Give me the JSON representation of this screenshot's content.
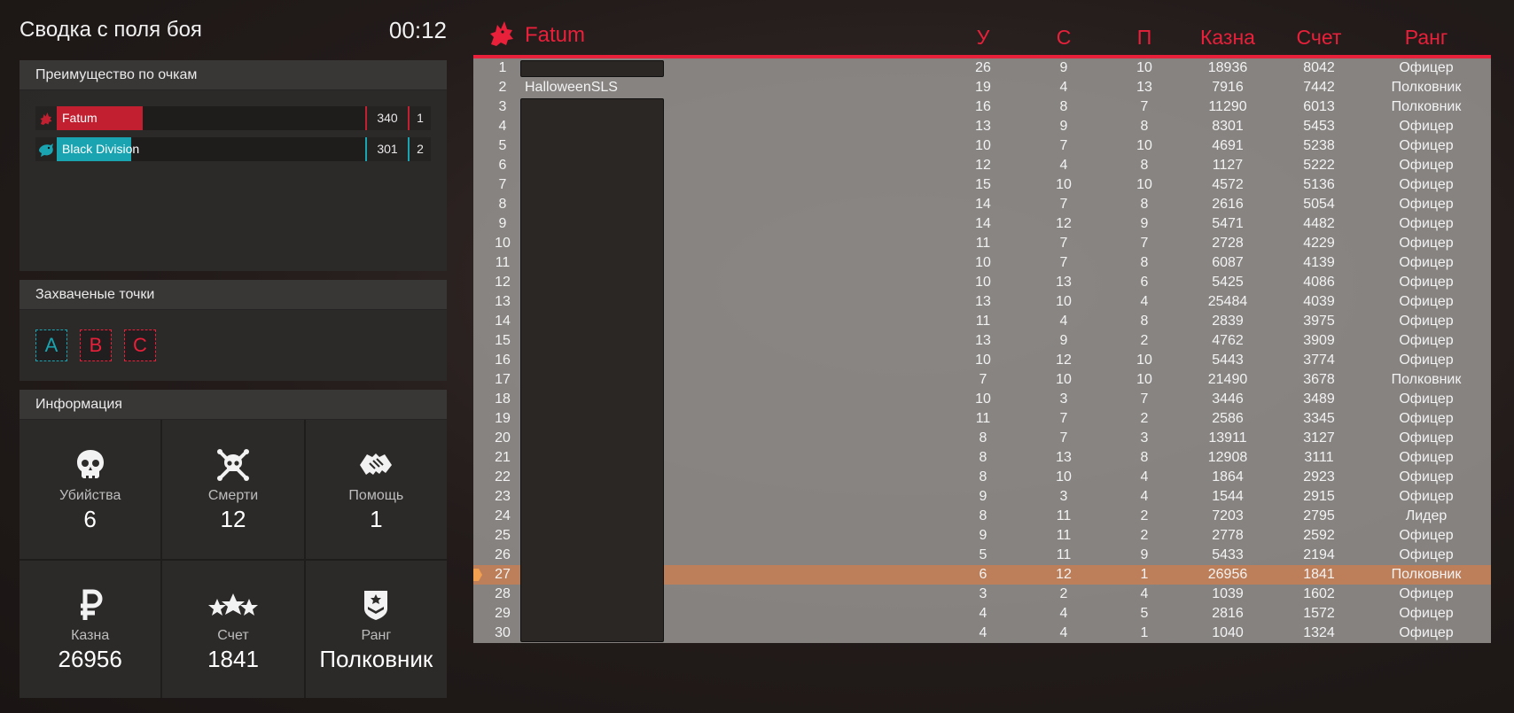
{
  "summary": {
    "title": "Сводка с поля боя",
    "timer": "00:12"
  },
  "advantage": {
    "title": "Преимущество по очкам",
    "teams": [
      {
        "name": "Fatum",
        "score": "340",
        "place": "1",
        "color": "#c22030",
        "fill_fraction": 0.28
      },
      {
        "name": "Black Division",
        "score": "301",
        "place": "2",
        "color": "#1aa3b0",
        "fill_fraction": 0.24
      }
    ]
  },
  "points": {
    "title": "Захваченые точки",
    "items": [
      {
        "label": "A",
        "color": "#1aa3b0"
      },
      {
        "label": "B",
        "color": "#e8203a"
      },
      {
        "label": "C",
        "color": "#e8203a"
      }
    ]
  },
  "info": {
    "title": "Информация",
    "kills": {
      "label": "Убийства",
      "value": "6",
      "icon": "skull-icon"
    },
    "deaths": {
      "label": "Смерти",
      "value": "12",
      "icon": "skull-crossbones-icon"
    },
    "assists": {
      "label": "Помощь",
      "value": "1",
      "icon": "handshake-icon"
    },
    "treasury": {
      "label": "Казна",
      "value": "26956",
      "icon": "ruble-icon"
    },
    "score": {
      "label": "Счет",
      "value": "1841",
      "icon": "stars-icon"
    },
    "rank": {
      "label": "Ранг",
      "value": "Полковник",
      "icon": "rank-chevron-icon"
    }
  },
  "board": {
    "team": "Fatum",
    "accent": "#e8203a",
    "columns": {
      "kills": "У",
      "deaths": "С",
      "assists": "П",
      "treasury": "Казна",
      "score": "Счет",
      "rank": "Ранг"
    },
    "visible_name": "HalloweenSLS",
    "rows": [
      {
        "n": "1",
        "name": "",
        "k": "26",
        "d": "9",
        "a": "10",
        "t": "18936",
        "s": "8042",
        "r": "Офицер"
      },
      {
        "n": "2",
        "name": "HalloweenSLS",
        "k": "19",
        "d": "4",
        "a": "13",
        "t": "7916",
        "s": "7442",
        "r": "Полковник"
      },
      {
        "n": "3",
        "name": "",
        "k": "16",
        "d": "8",
        "a": "7",
        "t": "11290",
        "s": "6013",
        "r": "Полковник"
      },
      {
        "n": "4",
        "name": "",
        "k": "13",
        "d": "9",
        "a": "8",
        "t": "8301",
        "s": "5453",
        "r": "Офицер"
      },
      {
        "n": "5",
        "name": "",
        "k": "10",
        "d": "7",
        "a": "10",
        "t": "4691",
        "s": "5238",
        "r": "Офицер"
      },
      {
        "n": "6",
        "name": "",
        "k": "12",
        "d": "4",
        "a": "8",
        "t": "1127",
        "s": "5222",
        "r": "Офицер"
      },
      {
        "n": "7",
        "name": "",
        "k": "15",
        "d": "10",
        "a": "10",
        "t": "4572",
        "s": "5136",
        "r": "Офицер"
      },
      {
        "n": "8",
        "name": "",
        "k": "14",
        "d": "7",
        "a": "8",
        "t": "2616",
        "s": "5054",
        "r": "Офицер"
      },
      {
        "n": "9",
        "name": "",
        "k": "14",
        "d": "12",
        "a": "9",
        "t": "5471",
        "s": "4482",
        "r": "Офицер"
      },
      {
        "n": "10",
        "name": "",
        "k": "11",
        "d": "7",
        "a": "7",
        "t": "2728",
        "s": "4229",
        "r": "Офицер"
      },
      {
        "n": "11",
        "name": "",
        "k": "10",
        "d": "7",
        "a": "8",
        "t": "6087",
        "s": "4139",
        "r": "Офицер"
      },
      {
        "n": "12",
        "name": "",
        "k": "10",
        "d": "13",
        "a": "6",
        "t": "5425",
        "s": "4086",
        "r": "Офицер"
      },
      {
        "n": "13",
        "name": "",
        "k": "13",
        "d": "10",
        "a": "4",
        "t": "25484",
        "s": "4039",
        "r": "Офицер"
      },
      {
        "n": "14",
        "name": "",
        "k": "11",
        "d": "4",
        "a": "8",
        "t": "2839",
        "s": "3975",
        "r": "Офицер"
      },
      {
        "n": "15",
        "name": "",
        "k": "13",
        "d": "9",
        "a": "2",
        "t": "4762",
        "s": "3909",
        "r": "Офицер"
      },
      {
        "n": "16",
        "name": "",
        "k": "10",
        "d": "12",
        "a": "10",
        "t": "5443",
        "s": "3774",
        "r": "Офицер"
      },
      {
        "n": "17",
        "name": "",
        "k": "7",
        "d": "10",
        "a": "10",
        "t": "21490",
        "s": "3678",
        "r": "Полковник"
      },
      {
        "n": "18",
        "name": "",
        "k": "10",
        "d": "3",
        "a": "7",
        "t": "3446",
        "s": "3489",
        "r": "Офицер"
      },
      {
        "n": "19",
        "name": "",
        "k": "11",
        "d": "7",
        "a": "2",
        "t": "2586",
        "s": "3345",
        "r": "Офицер"
      },
      {
        "n": "20",
        "name": "",
        "k": "8",
        "d": "7",
        "a": "3",
        "t": "13911",
        "s": "3127",
        "r": "Офицер"
      },
      {
        "n": "21",
        "name": "",
        "k": "8",
        "d": "13",
        "a": "8",
        "t": "12908",
        "s": "3111",
        "r": "Офицер"
      },
      {
        "n": "22",
        "name": "",
        "k": "8",
        "d": "10",
        "a": "4",
        "t": "1864",
        "s": "2923",
        "r": "Офицер"
      },
      {
        "n": "23",
        "name": "",
        "k": "9",
        "d": "3",
        "a": "4",
        "t": "1544",
        "s": "2915",
        "r": "Офицер"
      },
      {
        "n": "24",
        "name": "",
        "k": "8",
        "d": "11",
        "a": "2",
        "t": "7203",
        "s": "2795",
        "r": "Лидер"
      },
      {
        "n": "25",
        "name": "",
        "k": "9",
        "d": "11",
        "a": "2",
        "t": "2778",
        "s": "2592",
        "r": "Офицер"
      },
      {
        "n": "26",
        "name": "",
        "k": "5",
        "d": "11",
        "a": "9",
        "t": "5433",
        "s": "2194",
        "r": "Офицер"
      },
      {
        "n": "27",
        "name": "",
        "k": "6",
        "d": "12",
        "a": "1",
        "t": "26956",
        "s": "1841",
        "r": "Полковник",
        "me": true
      },
      {
        "n": "28",
        "name": "",
        "k": "3",
        "d": "2",
        "a": "4",
        "t": "1039",
        "s": "1602",
        "r": "Офицер"
      },
      {
        "n": "29",
        "name": "",
        "k": "4",
        "d": "4",
        "a": "5",
        "t": "2816",
        "s": "1572",
        "r": "Офицер"
      },
      {
        "n": "30",
        "name": "",
        "k": "4",
        "d": "4",
        "a": "1",
        "t": "1040",
        "s": "1324",
        "r": "Офицер"
      }
    ]
  }
}
